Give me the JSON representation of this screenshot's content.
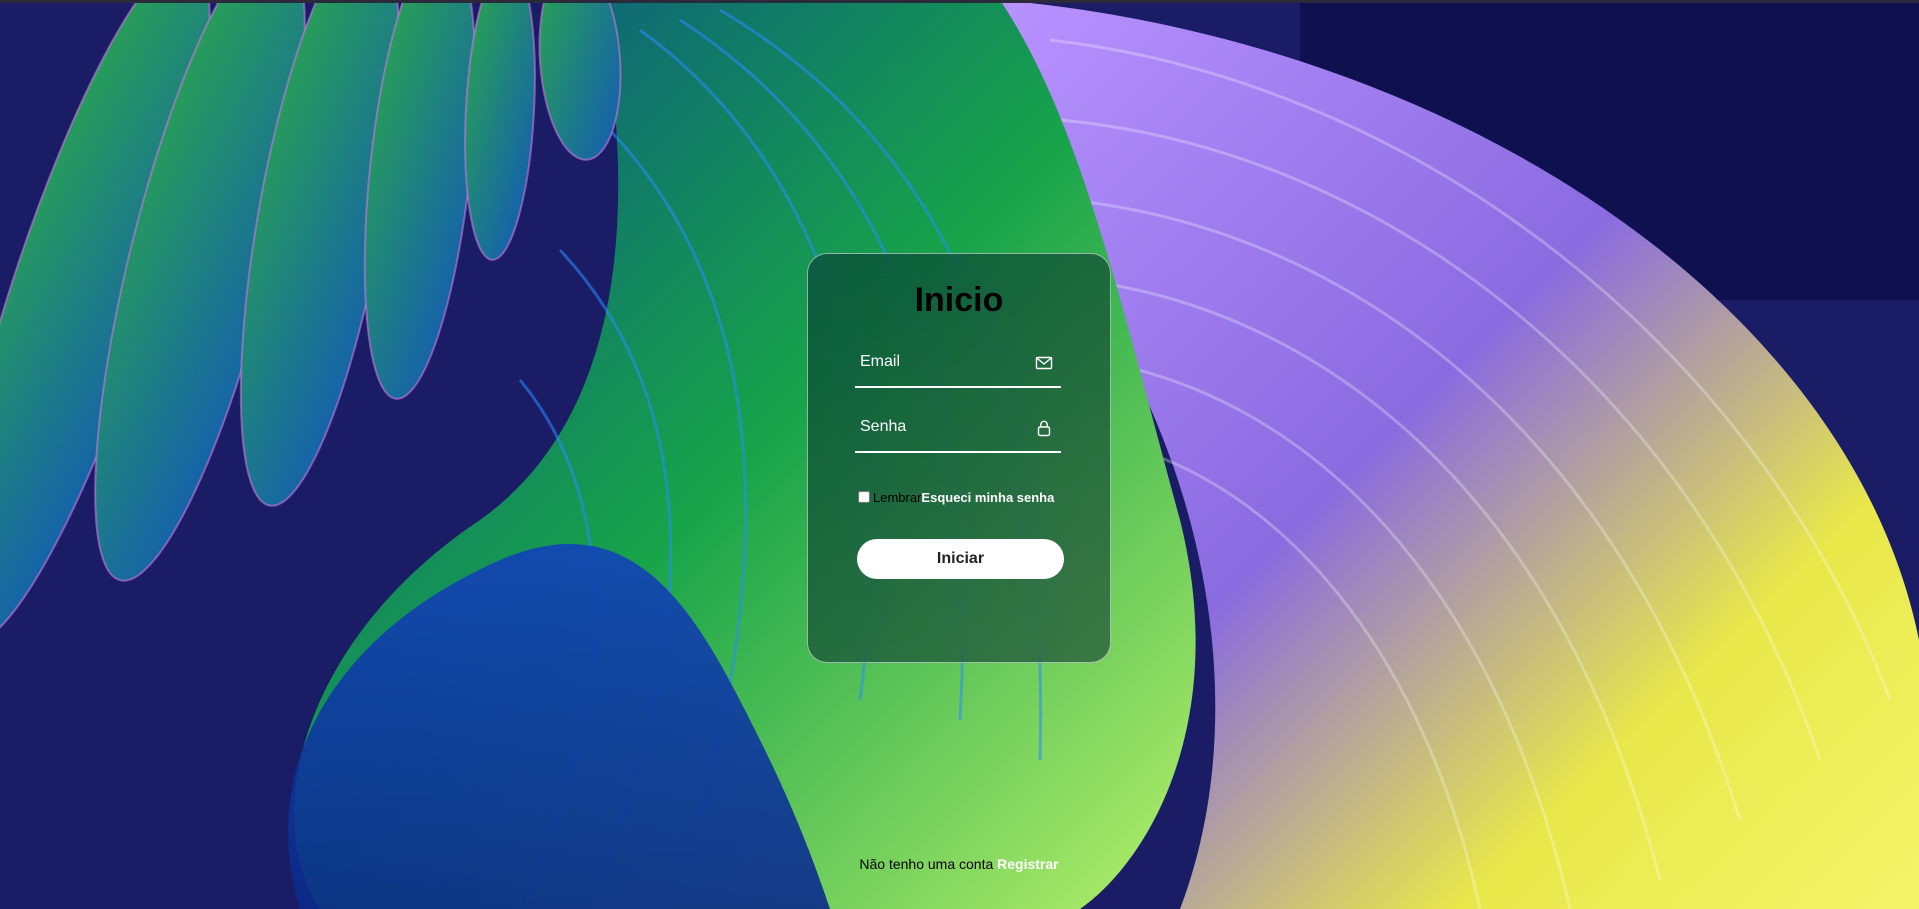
{
  "login": {
    "title": "Inicio",
    "email_placeholder": "Email",
    "password_placeholder": "Senha",
    "remember_label": "Lembrar",
    "forgot_label": "Esqueci minha senha",
    "submit_label": "Iniciar",
    "no_account_text": "Não tenho uma conta ",
    "register_label": "Registrar"
  },
  "icons": {
    "email": "envelope-icon",
    "password": "lock-icon"
  },
  "colors": {
    "card_tint": "#0b3a3a",
    "text": "#ffffff",
    "button_bg": "#ffffff",
    "button_text": "#222222",
    "page_bg": "#1a1a5e"
  }
}
